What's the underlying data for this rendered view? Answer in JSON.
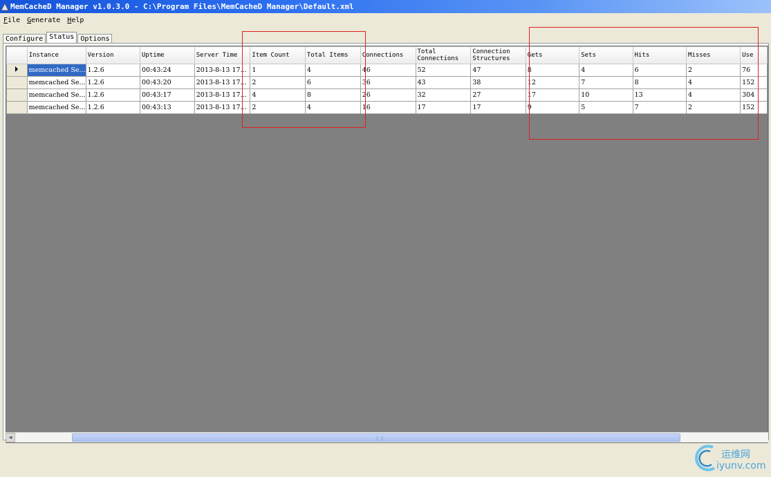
{
  "window": {
    "title": "MemCacheD Manager v1.0.3.0 - C:\\Program Files\\MemCacheD Manager\\Default.xml"
  },
  "menu": [
    {
      "key": "F",
      "rest": "ile"
    },
    {
      "key": "G",
      "rest": "enerate"
    },
    {
      "key": "H",
      "rest": "elp"
    }
  ],
  "tabs": [
    "Configure",
    "Status",
    "Options"
  ],
  "grid": {
    "columns": [
      "Instance",
      "Version",
      "Uptime",
      "Server Time",
      "Item Count",
      "Total Items",
      "Connections",
      "Total\nConnections",
      "Connection\nStructures",
      "Gets",
      "Sets",
      "Hits",
      "Misses",
      "Use"
    ],
    "rows": [
      [
        "memcached Se...",
        "1.2.6",
        "00:43:24",
        "2013-8-13 17...",
        "1",
        "4",
        "46",
        "52",
        "47",
        "8",
        "4",
        "6",
        "2",
        "76"
      ],
      [
        "memcached Se...",
        "1.2.6",
        "00:43:20",
        "2013-8-13 17...",
        "2",
        "6",
        "36",
        "43",
        "38",
        "12",
        "7",
        "8",
        "4",
        "152"
      ],
      [
        "memcached Se...",
        "1.2.6",
        "00:43:17",
        "2013-8-13 17...",
        "4",
        "8",
        "26",
        "32",
        "27",
        "17",
        "10",
        "13",
        "4",
        "304"
      ],
      [
        "memcached Se...",
        "1.2.6",
        "00:43:13",
        "2013-8-13 17...",
        "2",
        "4",
        "16",
        "17",
        "17",
        "9",
        "5",
        "7",
        "2",
        "152"
      ]
    ]
  },
  "watermark": {
    "cn": "运维网",
    "url": "iyunv.com"
  },
  "colors": {
    "selection": "#316ac5",
    "annotation": "#e02020",
    "empty_grid": "#808080"
  }
}
